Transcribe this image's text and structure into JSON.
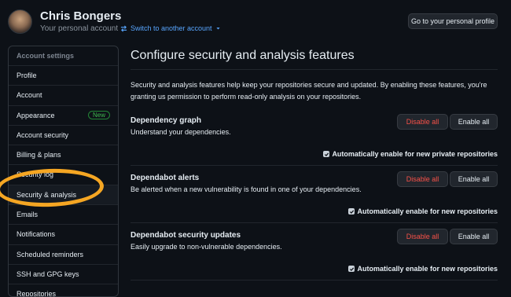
{
  "user": {
    "name": "Chris Bongers",
    "subtitle": "Your personal account",
    "switch_label": "Switch to another account",
    "profile_button": "Go to your personal profile"
  },
  "sidebar": {
    "heading": "Account settings",
    "items": [
      {
        "label": "Profile"
      },
      {
        "label": "Account"
      },
      {
        "label": "Appearance",
        "badge": "New"
      },
      {
        "label": "Account security"
      },
      {
        "label": "Billing & plans"
      },
      {
        "label": "Security log"
      },
      {
        "label": "Security & analysis",
        "active": true
      },
      {
        "label": "Emails"
      },
      {
        "label": "Notifications"
      },
      {
        "label": "Scheduled reminders"
      },
      {
        "label": "SSH and GPG keys"
      },
      {
        "label": "Repositories"
      }
    ]
  },
  "main": {
    "title": "Configure security and analysis features",
    "intro": "Security and analysis features help keep your repositories secure and updated. By enabling these features, you're granting us permission to perform read-only analysis on your repositories.",
    "features": [
      {
        "title": "Dependency graph",
        "description": "Understand your dependencies.",
        "disable_label": "Disable all",
        "enable_label": "Enable all",
        "auto_label": "Automatically enable for new private repositories",
        "auto_checked": true
      },
      {
        "title": "Dependabot alerts",
        "description": "Be alerted when a new vulnerability is found in one of your dependencies.",
        "disable_label": "Disable all",
        "enable_label": "Enable all",
        "auto_label": "Automatically enable for new repositories",
        "auto_checked": true
      },
      {
        "title": "Dependabot security updates",
        "description": "Easily upgrade to non-vulnerable dependencies.",
        "disable_label": "Disable all",
        "enable_label": "Enable all",
        "auto_label": "Automatically enable for new repositories",
        "auto_checked": true
      }
    ]
  },
  "colors": {
    "background": "#0d1117",
    "link": "#58a6ff",
    "danger": "#f85149",
    "highlight_ring": "#f5a623",
    "badge_green": "#3fb950"
  }
}
